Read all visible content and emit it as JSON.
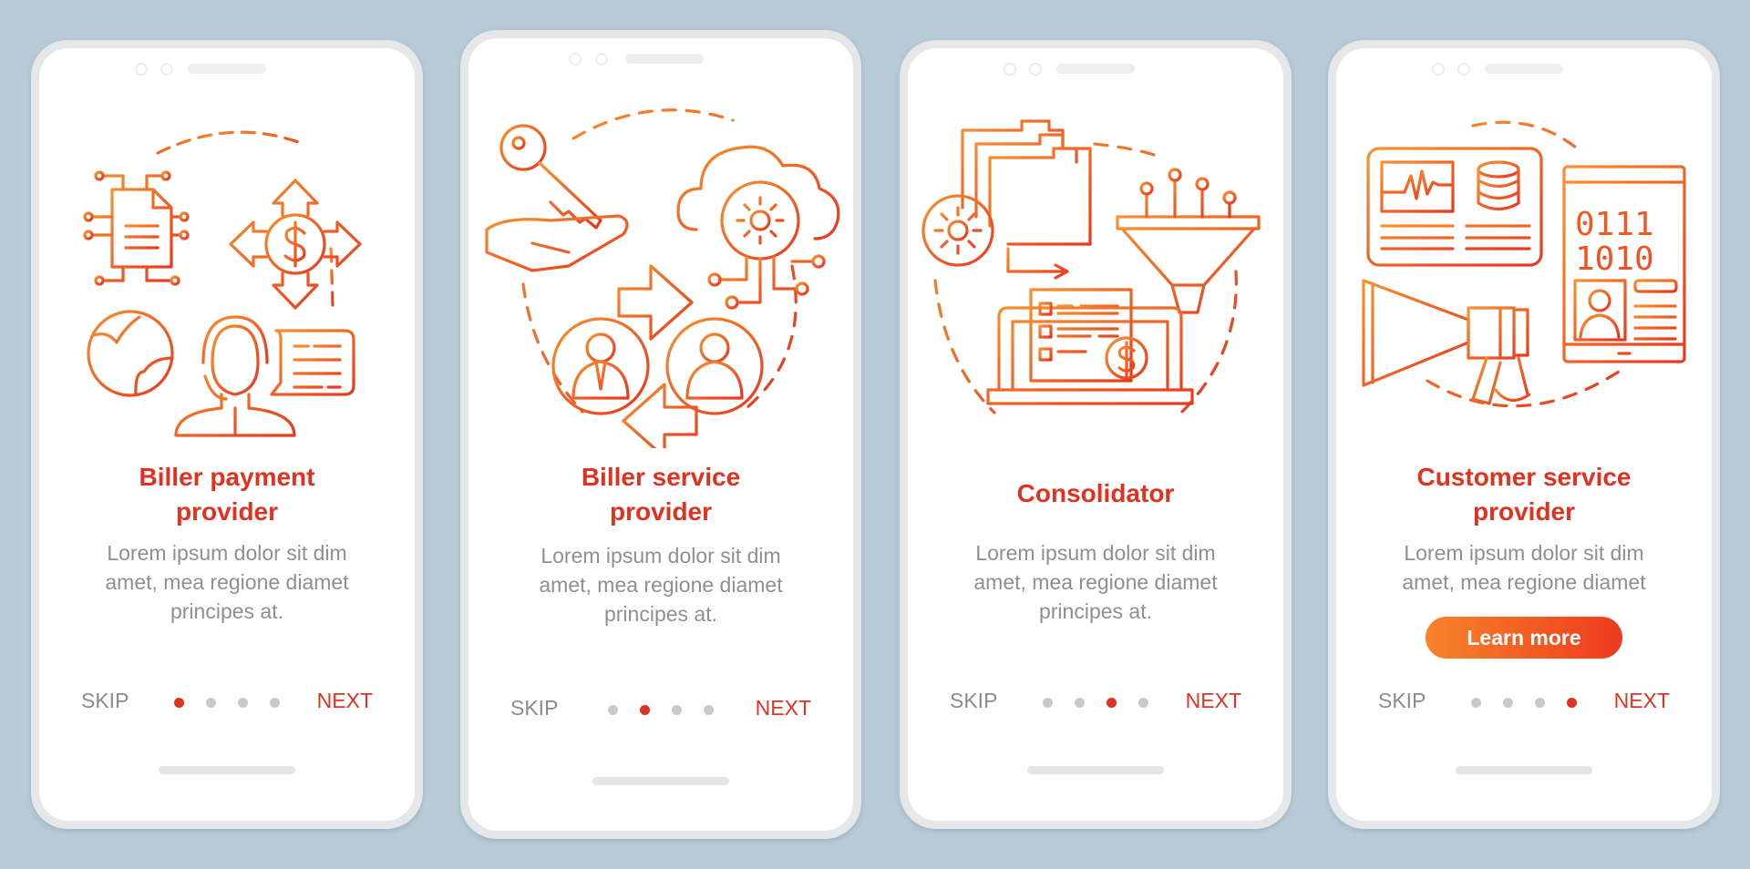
{
  "theme": {
    "accent": "#e0321e",
    "gradient_start": "#f7842a",
    "gradient_end": "#ee3a1d",
    "background": "#b7ccd7",
    "text_muted": "#8f8f8f",
    "dot_inactive": "#c9c9c9"
  },
  "screens": [
    {
      "title_line1": "Biller payment",
      "title_line2": "provider",
      "description_lines": [
        "Lorem ipsum dolor sit dim",
        "amet, mea regione diamet",
        "principes at."
      ],
      "skip_label": "SKIP",
      "next_label": "NEXT",
      "active_page": 1,
      "page_count": 4,
      "icons": [
        "document-network-icon",
        "dollar-arrows-icon",
        "globe-icon",
        "support-agent-headset-icon",
        "chat-bubble-icon"
      ]
    },
    {
      "title_line1": "Biller service",
      "title_line2": "provider",
      "description_lines": [
        "Lorem ipsum dolor sit dim",
        "amet, mea regione diamet",
        "principes at."
      ],
      "skip_label": "SKIP",
      "next_label": "NEXT",
      "active_page": 2,
      "page_count": 4,
      "icons": [
        "key-in-hand-icon",
        "cloud-gear-icon",
        "arrow-right-icon",
        "businessman-avatar-icon",
        "user-avatar-icon",
        "arrow-left-icon"
      ]
    },
    {
      "title_line1": "Consolidator",
      "description_lines": [
        "Lorem ipsum dolor sit dim",
        "amet, mea regione diamet",
        "principes at."
      ],
      "skip_label": "SKIP",
      "next_label": "NEXT",
      "active_page": 3,
      "page_count": 4,
      "icons": [
        "folders-gear-icon",
        "funnel-icon",
        "laptop-checklist-dollar-icon"
      ]
    },
    {
      "title_line1": "Customer service",
      "title_line2": "provider",
      "description_lines": [
        "Lorem ipsum dolor sit dim",
        "amet, mea regione diamet"
      ],
      "button_label": "Learn more",
      "skip_label": "SKIP",
      "next_label": "NEXT",
      "active_page": 4,
      "page_count": 4,
      "icons": [
        "dashboard-icon",
        "database-icon",
        "tablet-binary-profile-icon",
        "megaphone-icon"
      ],
      "binary_row1": "0111",
      "binary_row2": "1010"
    }
  ]
}
